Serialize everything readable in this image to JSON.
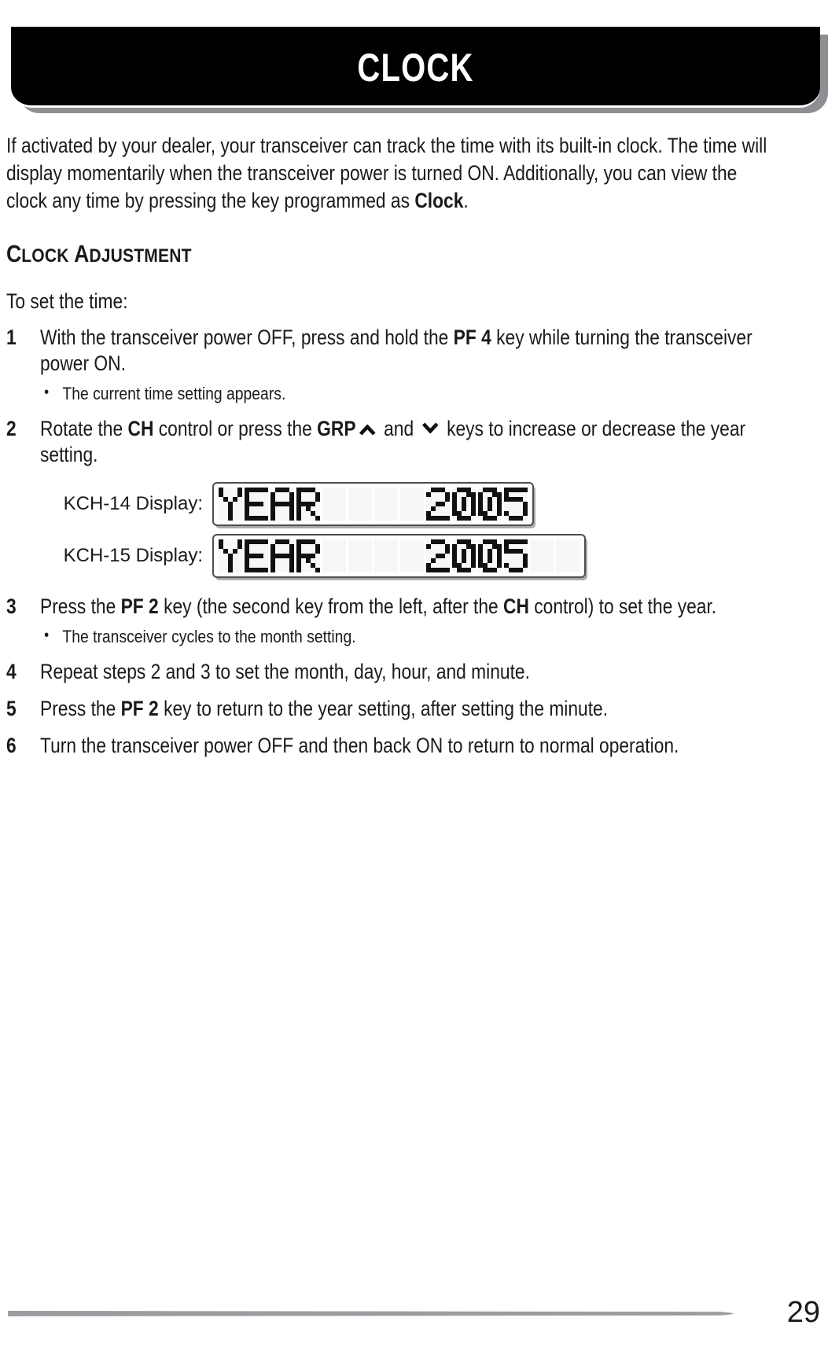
{
  "header": {
    "title": "CLOCK"
  },
  "intro": {
    "part1": "If activated by your dealer, your transceiver can track the time with its built-in clock.  The time will display momentarily when the transceiver power is turned ON.  Additionally, you can view the clock any time by pressing the key programmed as ",
    "bold_term": "Clock",
    "part2": "."
  },
  "section": {
    "heading_first_letter_1": "C",
    "heading_rest_1": "LOCK",
    "heading_space": " ",
    "heading_first_letter_2": "A",
    "heading_rest_2": "DJUSTMENT",
    "heading_full": "CLOCK ADJUSTMENT"
  },
  "lead_in": "To set the time:",
  "steps": [
    {
      "number": "1",
      "text_a": "With the transceiver power OFF, press and hold the ",
      "bold_a": "PF 4",
      "text_b": " key while turning the transceiver power ON.",
      "bullets": [
        "The current time setting appears."
      ]
    },
    {
      "number": "2",
      "text_a": "Rotate the ",
      "bold_a": "CH",
      "text_b": " control or press the ",
      "bold_b": "GRP",
      "icon_up": "chevron-up-icon",
      "text_c": " and ",
      "icon_down": "chevron-down-icon",
      "text_d": " keys to increase or decrease the year setting.",
      "bullets": []
    },
    {
      "number": "3",
      "text_a": "Press the ",
      "bold_a": "PF 2",
      "text_b": " key (the second key from the left, after the ",
      "bold_b": "CH",
      "text_c": " control) to set the year.",
      "bullets": [
        "The transceiver cycles to the month setting."
      ]
    },
    {
      "number": "4",
      "text_a": "Repeat steps 2 and 3 to set the month, day, hour, and minute.",
      "bullets": []
    },
    {
      "number": "5",
      "text_a": "Press the ",
      "bold_a": "PF 2",
      "text_b": " key to return to the year setting, after setting the minute.",
      "bullets": []
    },
    {
      "number": "6",
      "text_a": "Turn the transceiver power OFF and then back ON to return to normal operation.",
      "bullets": []
    }
  ],
  "displays": [
    {
      "label": "KCH-14 Display:",
      "cells": [
        "Y",
        "E",
        "A",
        "R",
        " ",
        " ",
        " ",
        " ",
        "2",
        "0",
        "0",
        "5"
      ],
      "text": "YEAR    2005"
    },
    {
      "label": "KCH-15 Display:",
      "cells": [
        "Y",
        "E",
        "A",
        "R",
        " ",
        " ",
        " ",
        " ",
        "2",
        "0",
        "0",
        "5",
        " ",
        " "
      ],
      "text": "YEAR    2005  "
    }
  ],
  "footer": {
    "page_number": "29"
  },
  "colors": {
    "header_bg": "#000000",
    "header_text": "#ffffff",
    "shadow": "#8d8f92",
    "body_text": "#1a1a1a",
    "lcd_border": "#4d4d4d",
    "lcd_cell_bg": "#f7f7f7",
    "lcd_pixel": "#111111"
  }
}
